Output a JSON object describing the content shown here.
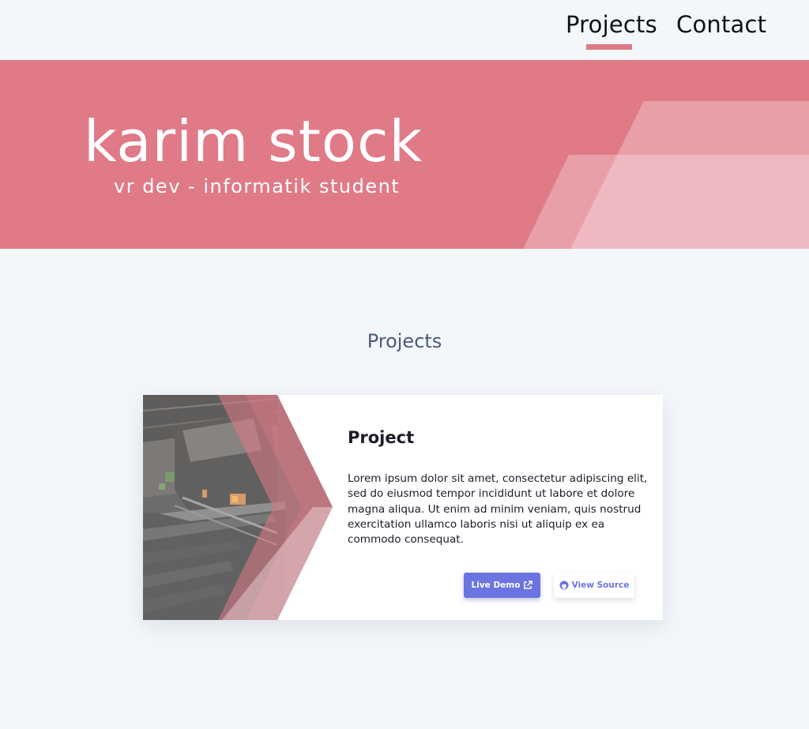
{
  "nav": {
    "items": [
      {
        "label": "Projects",
        "active": true
      },
      {
        "label": "Contact",
        "active": false
      }
    ],
    "accent_color": "#e07a87"
  },
  "hero": {
    "title": "karim stock",
    "subtitle": "vr dev - informatik student",
    "background_color": "#e07a87"
  },
  "projects_section": {
    "title": "Projects",
    "cards": [
      {
        "title": "Project",
        "description": "Lorem ipsum dolor sit amet, consectetur adipiscing elit, sed do eiusmod tempor incididunt ut labore et dolore magna aliqua. Ut enim ad minim veniam, quis nostrud exercitation ullamco laboris nisi ut aliquip ex ea commodo consequat.",
        "live_demo_label": "Live Demo",
        "live_demo_icon": "external-link-icon",
        "view_source_label": "View Source",
        "view_source_icon": "github-icon",
        "button_color": "#6b74e0"
      }
    ]
  }
}
